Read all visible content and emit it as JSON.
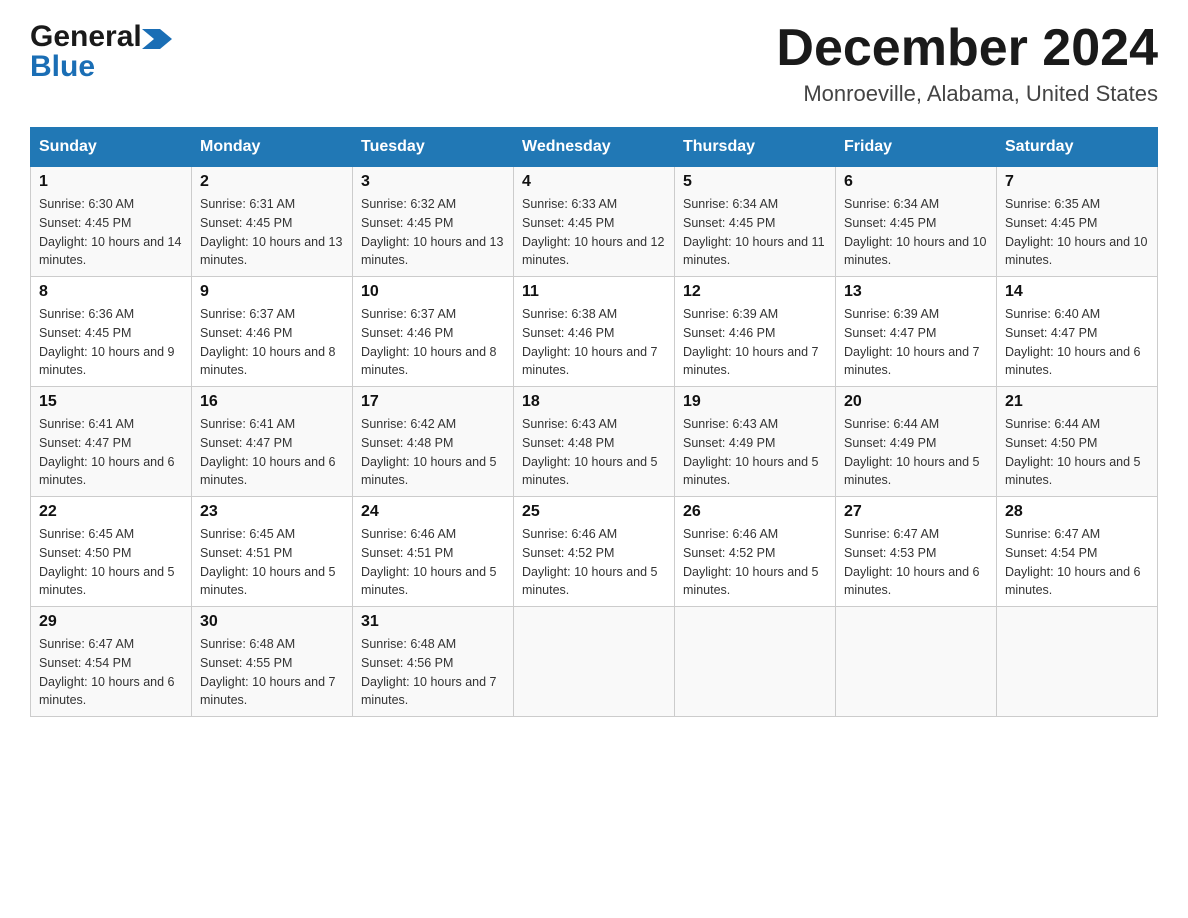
{
  "header": {
    "logo_general": "General",
    "logo_blue": "Blue",
    "month_title": "December 2024",
    "location": "Monroeville, Alabama, United States"
  },
  "days_of_week": [
    "Sunday",
    "Monday",
    "Tuesday",
    "Wednesday",
    "Thursday",
    "Friday",
    "Saturday"
  ],
  "weeks": [
    [
      {
        "day": "1",
        "sunrise": "6:30 AM",
        "sunset": "4:45 PM",
        "daylight": "10 hours and 14 minutes."
      },
      {
        "day": "2",
        "sunrise": "6:31 AM",
        "sunset": "4:45 PM",
        "daylight": "10 hours and 13 minutes."
      },
      {
        "day": "3",
        "sunrise": "6:32 AM",
        "sunset": "4:45 PM",
        "daylight": "10 hours and 13 minutes."
      },
      {
        "day": "4",
        "sunrise": "6:33 AM",
        "sunset": "4:45 PM",
        "daylight": "10 hours and 12 minutes."
      },
      {
        "day": "5",
        "sunrise": "6:34 AM",
        "sunset": "4:45 PM",
        "daylight": "10 hours and 11 minutes."
      },
      {
        "day": "6",
        "sunrise": "6:34 AM",
        "sunset": "4:45 PM",
        "daylight": "10 hours and 10 minutes."
      },
      {
        "day": "7",
        "sunrise": "6:35 AM",
        "sunset": "4:45 PM",
        "daylight": "10 hours and 10 minutes."
      }
    ],
    [
      {
        "day": "8",
        "sunrise": "6:36 AM",
        "sunset": "4:45 PM",
        "daylight": "10 hours and 9 minutes."
      },
      {
        "day": "9",
        "sunrise": "6:37 AM",
        "sunset": "4:46 PM",
        "daylight": "10 hours and 8 minutes."
      },
      {
        "day": "10",
        "sunrise": "6:37 AM",
        "sunset": "4:46 PM",
        "daylight": "10 hours and 8 minutes."
      },
      {
        "day": "11",
        "sunrise": "6:38 AM",
        "sunset": "4:46 PM",
        "daylight": "10 hours and 7 minutes."
      },
      {
        "day": "12",
        "sunrise": "6:39 AM",
        "sunset": "4:46 PM",
        "daylight": "10 hours and 7 minutes."
      },
      {
        "day": "13",
        "sunrise": "6:39 AM",
        "sunset": "4:47 PM",
        "daylight": "10 hours and 7 minutes."
      },
      {
        "day": "14",
        "sunrise": "6:40 AM",
        "sunset": "4:47 PM",
        "daylight": "10 hours and 6 minutes."
      }
    ],
    [
      {
        "day": "15",
        "sunrise": "6:41 AM",
        "sunset": "4:47 PM",
        "daylight": "10 hours and 6 minutes."
      },
      {
        "day": "16",
        "sunrise": "6:41 AM",
        "sunset": "4:47 PM",
        "daylight": "10 hours and 6 minutes."
      },
      {
        "day": "17",
        "sunrise": "6:42 AM",
        "sunset": "4:48 PM",
        "daylight": "10 hours and 5 minutes."
      },
      {
        "day": "18",
        "sunrise": "6:43 AM",
        "sunset": "4:48 PM",
        "daylight": "10 hours and 5 minutes."
      },
      {
        "day": "19",
        "sunrise": "6:43 AM",
        "sunset": "4:49 PM",
        "daylight": "10 hours and 5 minutes."
      },
      {
        "day": "20",
        "sunrise": "6:44 AM",
        "sunset": "4:49 PM",
        "daylight": "10 hours and 5 minutes."
      },
      {
        "day": "21",
        "sunrise": "6:44 AM",
        "sunset": "4:50 PM",
        "daylight": "10 hours and 5 minutes."
      }
    ],
    [
      {
        "day": "22",
        "sunrise": "6:45 AM",
        "sunset": "4:50 PM",
        "daylight": "10 hours and 5 minutes."
      },
      {
        "day": "23",
        "sunrise": "6:45 AM",
        "sunset": "4:51 PM",
        "daylight": "10 hours and 5 minutes."
      },
      {
        "day": "24",
        "sunrise": "6:46 AM",
        "sunset": "4:51 PM",
        "daylight": "10 hours and 5 minutes."
      },
      {
        "day": "25",
        "sunrise": "6:46 AM",
        "sunset": "4:52 PM",
        "daylight": "10 hours and 5 minutes."
      },
      {
        "day": "26",
        "sunrise": "6:46 AM",
        "sunset": "4:52 PM",
        "daylight": "10 hours and 5 minutes."
      },
      {
        "day": "27",
        "sunrise": "6:47 AM",
        "sunset": "4:53 PM",
        "daylight": "10 hours and 6 minutes."
      },
      {
        "day": "28",
        "sunrise": "6:47 AM",
        "sunset": "4:54 PM",
        "daylight": "10 hours and 6 minutes."
      }
    ],
    [
      {
        "day": "29",
        "sunrise": "6:47 AM",
        "sunset": "4:54 PM",
        "daylight": "10 hours and 6 minutes."
      },
      {
        "day": "30",
        "sunrise": "6:48 AM",
        "sunset": "4:55 PM",
        "daylight": "10 hours and 7 minutes."
      },
      {
        "day": "31",
        "sunrise": "6:48 AM",
        "sunset": "4:56 PM",
        "daylight": "10 hours and 7 minutes."
      },
      null,
      null,
      null,
      null
    ]
  ],
  "labels": {
    "sunrise": "Sunrise:",
    "sunset": "Sunset:",
    "daylight": "Daylight:"
  }
}
